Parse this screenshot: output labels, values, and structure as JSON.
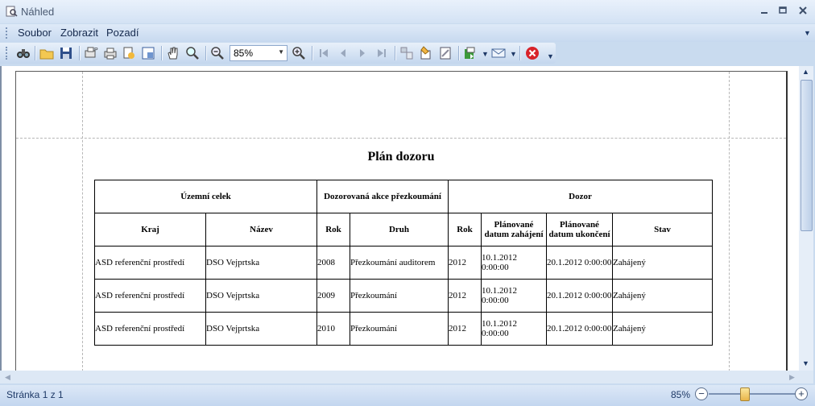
{
  "window": {
    "title": "Náhled"
  },
  "menu": [
    "Soubor",
    "Zobrazit",
    "Pozadí"
  ],
  "toolbar": {
    "zoom_value": "85%",
    "icons": [
      "binoculars-icon",
      "open-folder-icon",
      "save-icon",
      "page-setup-icon",
      "print-icon",
      "quick-print-icon",
      "scale-icon",
      "hand-tool-icon",
      "magnifier-icon",
      "zoom-out-icon",
      "zoom-in-icon",
      "first-page-icon",
      "previous-page-icon",
      "next-page-icon",
      "last-page-icon",
      "multiple-pages-icon",
      "page-color-icon",
      "watermark-icon",
      "export-icon",
      "email-icon",
      "close-preview-icon"
    ]
  },
  "report": {
    "title": "Plán dozoru",
    "group_headers": [
      "Územní celek",
      "Dozorovaná akce přezkoumání",
      "Dozor"
    ],
    "columns": [
      "Kraj",
      "Název",
      "Rok",
      "Druh",
      "Rok",
      "Plánované datum zahájení",
      "Plánované datum ukončení",
      "Stav"
    ],
    "rows": [
      [
        "ASD referenční prostředí",
        "DSO Vejprtska",
        "2008",
        "Přezkoumání auditorem",
        "2012",
        "10.1.2012 0:00:00",
        "20.1.2012 0:00:00",
        "Zahájený"
      ],
      [
        "ASD referenční prostředí",
        "DSO Vejprtska",
        "2009",
        "Přezkoumání",
        "2012",
        "10.1.2012 0:00:00",
        "20.1.2012 0:00:00",
        "Zahájený"
      ],
      [
        "ASD referenční prostředí",
        "DSO Vejprtska",
        "2010",
        "Přezkoumání",
        "2012",
        "10.1.2012 0:00:00",
        "20.1.2012 0:00:00",
        "Zahájený"
      ]
    ]
  },
  "status": {
    "page_info": "Stránka 1 z 1",
    "zoom_percent": "85%",
    "zoom_slider_fraction": 0.42
  }
}
